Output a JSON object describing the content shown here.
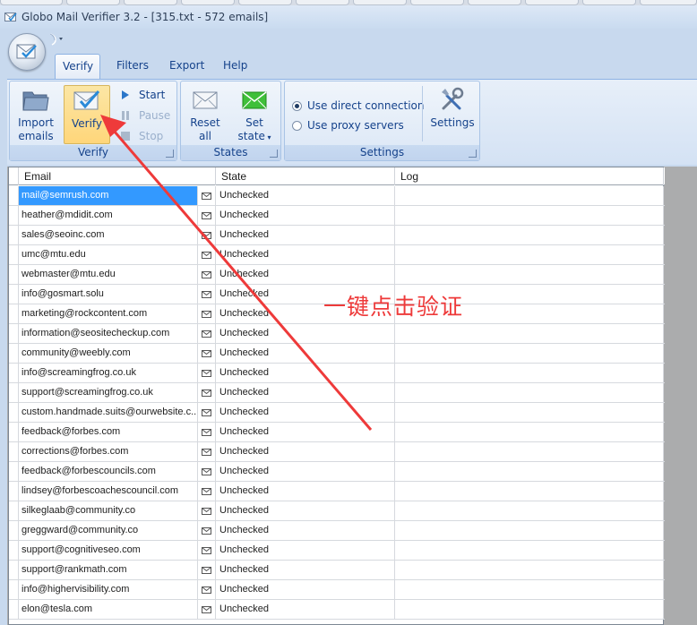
{
  "window": {
    "title": "Globo Mail Verifier 3.2 - [315.txt - 572 emails]"
  },
  "ribbon": {
    "tabs": [
      {
        "label": "Verify",
        "active": true
      },
      {
        "label": "Filters",
        "active": false
      },
      {
        "label": "Export",
        "active": false
      },
      {
        "label": "Help",
        "active": false
      }
    ],
    "verify_group": {
      "label": "Verify",
      "import_line1": "Import",
      "import_line2": "emails",
      "verify_label": "Verify",
      "start_label": "Start",
      "pause_label": "Pause",
      "stop_label": "Stop"
    },
    "states_group": {
      "label": "States",
      "reset_line1": "Reset",
      "reset_line2": "all",
      "set_line1": "Set",
      "set_line2": "state"
    },
    "settings_group": {
      "label": "Settings",
      "direct_label": "Use direct connection",
      "proxy_label": "Use proxy servers",
      "direct_selected": true,
      "settings_label": "Settings"
    }
  },
  "grid": {
    "columns": {
      "email": "Email",
      "state": "State",
      "log": "Log"
    },
    "rows": [
      {
        "email": "mail@semrush.com",
        "state": "Unchecked",
        "log": ""
      },
      {
        "email": "heather@mdidit.com",
        "state": "Unchecked",
        "log": ""
      },
      {
        "email": "sales@seoinc.com",
        "state": "Unchecked",
        "log": ""
      },
      {
        "email": "umc@mtu.edu",
        "state": "Unchecked",
        "log": ""
      },
      {
        "email": "webmaster@mtu.edu",
        "state": "Unchecked",
        "log": ""
      },
      {
        "email": "info@gosmart.solu",
        "state": "Unchecked",
        "log": ""
      },
      {
        "email": "marketing@rockcontent.com",
        "state": "Unchecked",
        "log": ""
      },
      {
        "email": "information@seositecheckup.com",
        "state": "Unchecked",
        "log": ""
      },
      {
        "email": "community@weebly.com",
        "state": "Unchecked",
        "log": ""
      },
      {
        "email": "info@screamingfrog.co.uk",
        "state": "Unchecked",
        "log": ""
      },
      {
        "email": "support@screamingfrog.co.uk",
        "state": "Unchecked",
        "log": ""
      },
      {
        "email": "custom.handmade.suits@ourwebsite.c...",
        "state": "Unchecked",
        "log": ""
      },
      {
        "email": "feedback@forbes.com",
        "state": "Unchecked",
        "log": ""
      },
      {
        "email": "corrections@forbes.com",
        "state": "Unchecked",
        "log": ""
      },
      {
        "email": "feedback@forbescouncils.com",
        "state": "Unchecked",
        "log": ""
      },
      {
        "email": "lindsey@forbescoachescouncil.com",
        "state": "Unchecked",
        "log": ""
      },
      {
        "email": "silkeglaab@community.co",
        "state": "Unchecked",
        "log": ""
      },
      {
        "email": "greggward@community.co",
        "state": "Unchecked",
        "log": ""
      },
      {
        "email": "support@cognitiveseo.com",
        "state": "Unchecked",
        "log": ""
      },
      {
        "email": "support@rankmath.com",
        "state": "Unchecked",
        "log": ""
      },
      {
        "email": "info@highervisibility.com",
        "state": "Unchecked",
        "log": ""
      },
      {
        "email": "elon@tesla.com",
        "state": "Unchecked",
        "log": ""
      }
    ]
  },
  "annotation": {
    "text": "一键点击验证",
    "color": "#ee3a3a"
  },
  "colors": {
    "selection": "#3399ff",
    "ribbon_text": "#15428b",
    "annotation": "#ee3a3a"
  }
}
